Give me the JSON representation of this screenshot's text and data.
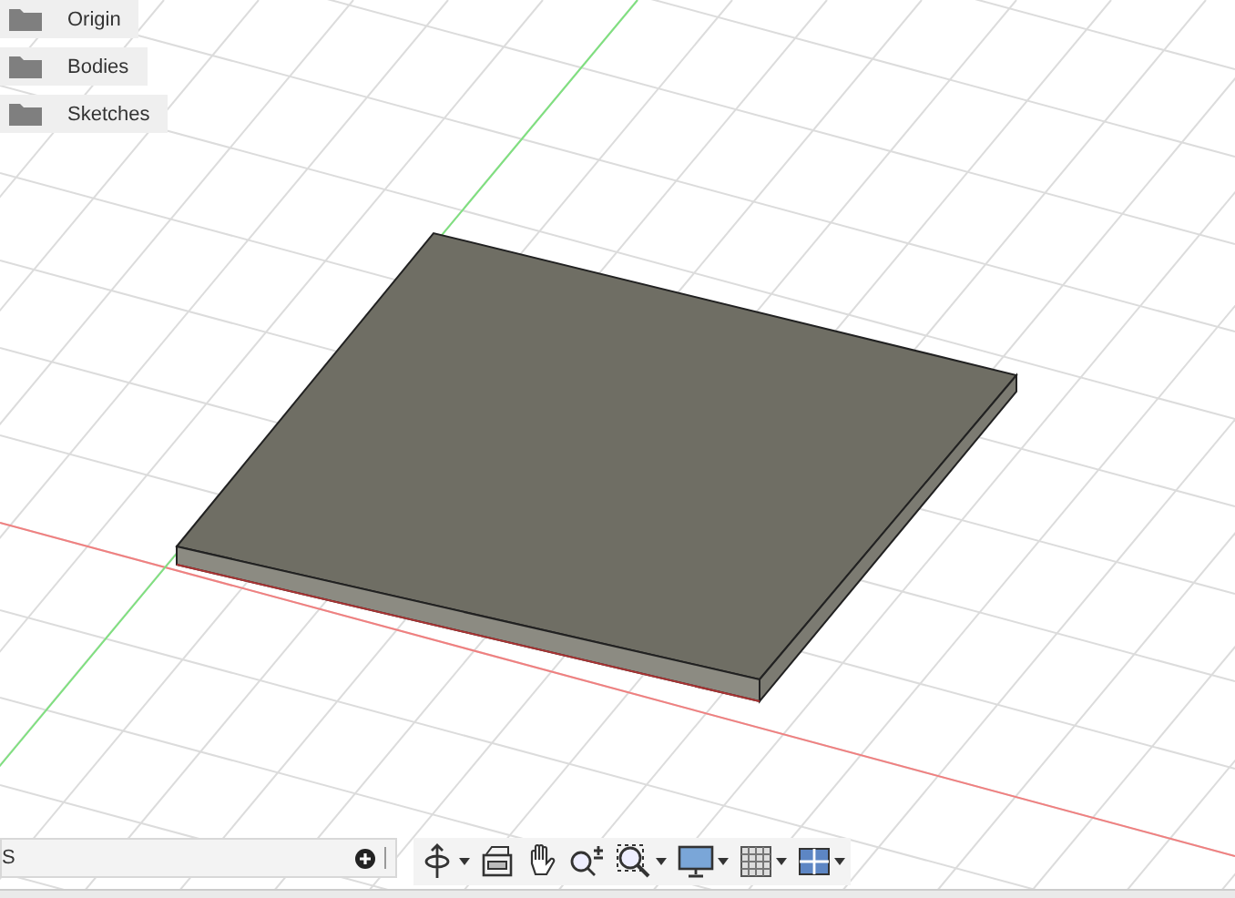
{
  "browser": {
    "items": [
      {
        "label": "Origin",
        "kind": "folder"
      },
      {
        "label": "Bodies",
        "kind": "folder"
      },
      {
        "label": "Sketches",
        "kind": "folder"
      }
    ]
  },
  "comments_panel": {
    "label": "S"
  },
  "navigation_toolbar": {
    "tools": [
      {
        "kind": "orbit",
        "dropdown": true
      },
      {
        "kind": "look-at",
        "dropdown": false
      },
      {
        "kind": "pan",
        "dropdown": false
      },
      {
        "kind": "zoom",
        "dropdown": false
      },
      {
        "kind": "zoom-window",
        "dropdown": true
      },
      {
        "kind": "display",
        "dropdown": true
      },
      {
        "kind": "grid",
        "dropdown": true
      },
      {
        "kind": "viewports",
        "dropdown": true
      }
    ]
  }
}
